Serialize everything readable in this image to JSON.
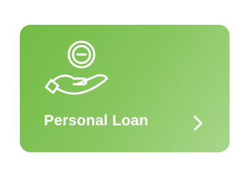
{
  "card": {
    "label": "Personal Loan",
    "icon": "hand-holding-coin-icon",
    "action_icon": "chevron-right-icon",
    "gradient_start": "#72bb45",
    "gradient_end": "#a8d68a",
    "text_color": "#ffffff"
  }
}
